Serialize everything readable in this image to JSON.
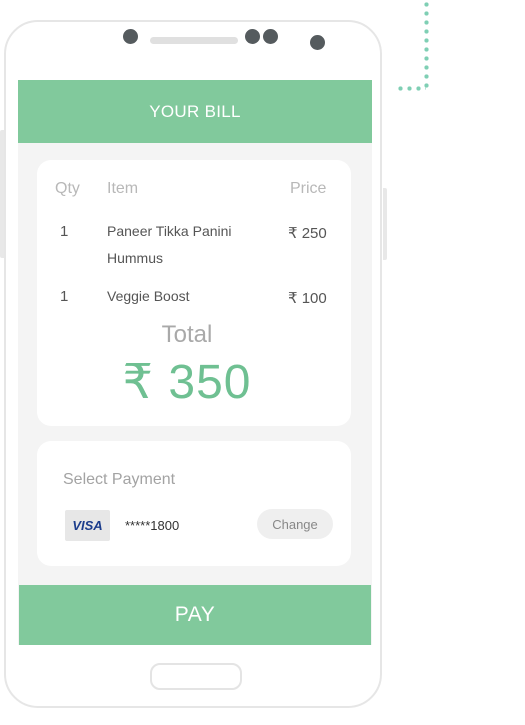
{
  "header": {
    "title": "YOUR BILL"
  },
  "bill": {
    "columns": {
      "qty": "Qty",
      "item": "Item",
      "price": "Price"
    },
    "items": [
      {
        "qty": "1",
        "name_line1": "Paneer Tikka  Panini",
        "name_line2": "Hummus",
        "price": "₹ 250"
      },
      {
        "qty": "1",
        "name_line1": "Veggie Boost",
        "name_line2": "",
        "price": "₹ 100"
      }
    ],
    "total_label": "Total",
    "total_value": "₹ 350"
  },
  "payment": {
    "label": "Select Payment",
    "card_brand": "VISA",
    "card_number": "*****1800",
    "change_label": "Change"
  },
  "pay_button": {
    "label": "PAY"
  },
  "colors": {
    "accent_green": "#81c99c",
    "total_green": "#6fc092",
    "screen_bg": "#f4f4f4",
    "dots": "#7fcfb4"
  }
}
